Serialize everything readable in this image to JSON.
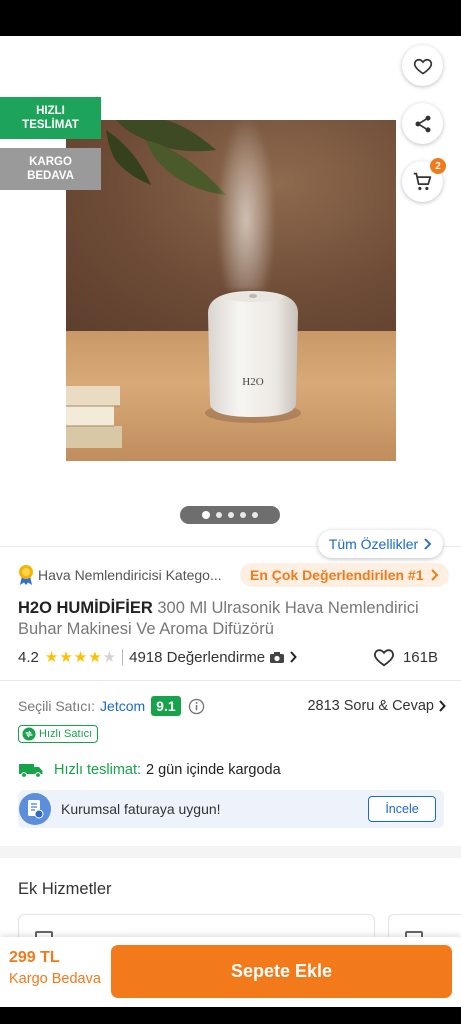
{
  "badges": {
    "fast_delivery_line1": "HIZLI",
    "fast_delivery_line2": "TESLİMAT",
    "free_cargo_line1": "KARGO",
    "free_cargo_line2": "BEDAVA"
  },
  "header": {
    "cart_count": "2",
    "icons": [
      "back-arrow-icon",
      "heart-icon",
      "share-icon",
      "cart-icon"
    ]
  },
  "gallery": {
    "image_count": 5,
    "active_index": 0,
    "device_text": "H2O"
  },
  "features_link": "Tüm Özellikler",
  "category": {
    "text": "Hava Nemlendiricisi Katego...",
    "best_rated": "En Çok Değerlendirilen #1"
  },
  "product": {
    "brand": "H2O HUMİDİFİER",
    "title": "300 Ml Ulrasonik Hava Nemlendirici Buhar Makinesi Ve Aroma Difüzörü"
  },
  "rating": {
    "score": "4.2",
    "stars": 4.2,
    "reviews_text": "4918 Değerlendirme",
    "favorites": "161B"
  },
  "seller": {
    "label": "Seçili Satıcı:",
    "name": "Jetcom",
    "score": "9.1",
    "qa_text": "2813 Soru & Cevap",
    "fast_seller_badge": "Hızlı Satıcı"
  },
  "delivery": {
    "label": "Hızlı teslimat:",
    "text": "2 gün içinde kargoda"
  },
  "invoice": {
    "text": "Kurumsal faturaya uygun!",
    "button": "İncele"
  },
  "extra_services": {
    "title": "Ek Hizmetler"
  },
  "bottom": {
    "price": "299 TL",
    "shipping": "Kargo Bedava",
    "add_to_cart": "Sepete Ekle"
  },
  "colors": {
    "accent_orange": "#f27a1a",
    "green": "#17a34a",
    "link_blue": "#1a6ad1"
  }
}
